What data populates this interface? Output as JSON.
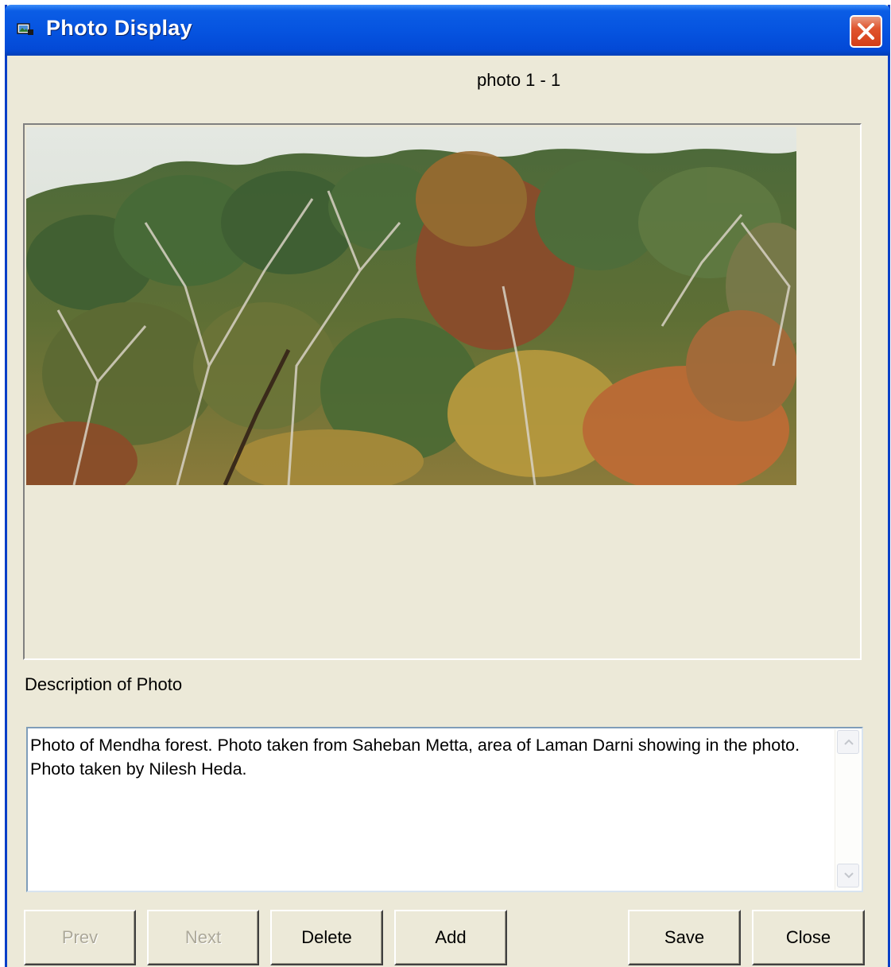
{
  "window": {
    "title": "Photo Display",
    "icon": "photo-app-icon"
  },
  "photo_counter": "photo  1 - 1",
  "description": {
    "label": "Description of Photo",
    "text": "Photo of Mendha forest. Photo taken from Saheban Metta, area of Laman Darni showing in the photo. Photo taken by Nilesh Heda."
  },
  "buttons": {
    "prev": "Prev",
    "next": "Next",
    "delete": "Delete",
    "add": "Add",
    "save": "Save",
    "close": "Close"
  },
  "colors": {
    "titlebar": "#0654e0",
    "close_button": "#e0552f",
    "face": "#ece9d8",
    "disabled_text": "#aca899"
  }
}
